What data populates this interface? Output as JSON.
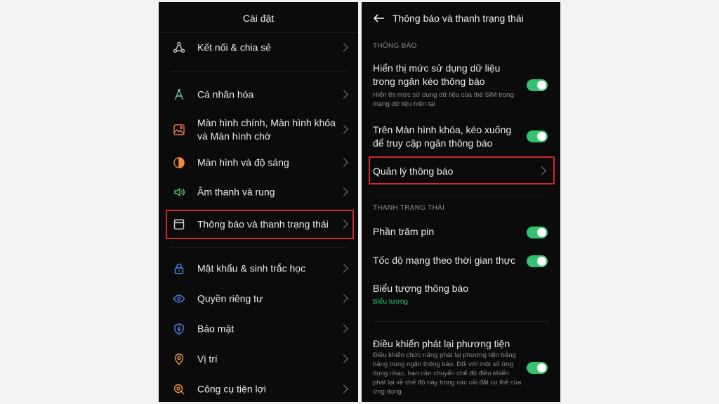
{
  "left": {
    "title": "Cài đặt",
    "items": [
      {
        "label": "Kết nối & chia sẻ",
        "icon": "share-icon",
        "color": "#c9c9c9"
      },
      {
        "label": "Cá nhân hóa",
        "icon": "personalize-icon",
        "color": "#6fc6a3"
      },
      {
        "label": "Màn hình chính, Màn hình khóa và Màn hình chờ",
        "icon": "wallpaper-icon",
        "color": "#e9774e"
      },
      {
        "label": "Màn hình và độ sáng",
        "icon": "brightness-icon",
        "color": "#ef8a3e"
      },
      {
        "label": "Âm thanh và rung",
        "icon": "sound-icon",
        "color": "#58c26a"
      },
      {
        "label": "Thông báo và thanh trạng thái",
        "icon": "notification-icon",
        "color": "#d7d7d7"
      },
      {
        "label": "Mật khẩu & sinh trắc học",
        "icon": "lock-icon",
        "color": "#4e86e8"
      },
      {
        "label": "Quyền riêng tư",
        "icon": "privacy-eye-icon",
        "color": "#4e86e8"
      },
      {
        "label": "Bảo mật",
        "icon": "shield-icon",
        "color": "#4e86e8"
      },
      {
        "label": "Vị trí",
        "icon": "location-icon",
        "color": "#f0953c"
      },
      {
        "label": "Công cụ tiện lợi",
        "icon": "tools-icon",
        "color": "#f0953c"
      }
    ]
  },
  "right": {
    "title": "Thông báo và thanh trạng thái",
    "section_notifications": "THÔNG BÁO",
    "data_usage": {
      "title": "Hiển thị mức sử dụng dữ liệu trong ngăn kéo thông báo",
      "subtitle": "Hiển thị mức sử dụng dữ liệu của thẻ SIM trong mạng dữ liệu hiện tại",
      "enabled": true
    },
    "lockscreen_pull": {
      "title": "Trên Màn hình khóa, kéo xuống để truy cập ngăn thông báo",
      "enabled": true
    },
    "manage_notifications": "Quản lý thông báo",
    "section_status_bar": "THANH TRẠNG THÁI",
    "battery_percent": {
      "title": "Phần trăm pin",
      "enabled": true
    },
    "network_speed": {
      "title": "Tốc độ mạng theo thời gian thực",
      "enabled": true
    },
    "notification_icons": {
      "title": "Biểu tượng thông báo",
      "value": "Biểu tượng"
    },
    "media_controls": {
      "title": "Điều khiển phát lại phương tiện",
      "subtitle": "Điều khiển chức năng phát lại phương tiện bằng bảng trong ngăn thông báo. Đối với một số ứng dụng nhạc, bạn cần chuyển chế độ điều khiển phát lại về chế độ này trong các cài đặt cụ thể của ứng dụng.",
      "enabled": true
    }
  },
  "colors": {
    "toggle_on": "#33c26f",
    "highlight": "#d0262c",
    "accent_text": "#2fbf6e"
  }
}
